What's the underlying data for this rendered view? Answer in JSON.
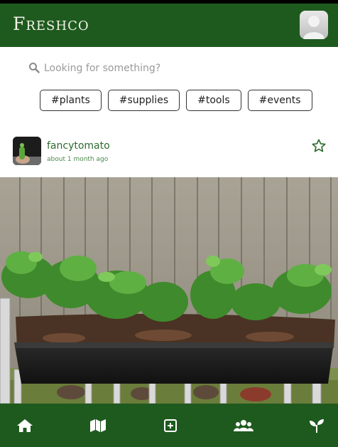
{
  "app": {
    "title": "Freshco"
  },
  "search": {
    "placeholder": "Looking for something?"
  },
  "tags": [
    "#plants",
    "#supplies",
    "#tools",
    "#events"
  ],
  "post": {
    "username": "fancytomato",
    "timestamp": "about 1 month ago",
    "image": "raised planter box with seedlings on a balcony"
  },
  "icons": {
    "search": "search-icon",
    "profile": "user-avatar-icon",
    "favorite": "star-outline-icon",
    "nav": [
      "home-icon",
      "map-icon",
      "add-post-icon",
      "community-icon",
      "seedling-icon"
    ]
  },
  "colors": {
    "brand": "#1e5a1e",
    "accent_text": "#2e6b2e",
    "logo_text": "#f3f3e8"
  }
}
